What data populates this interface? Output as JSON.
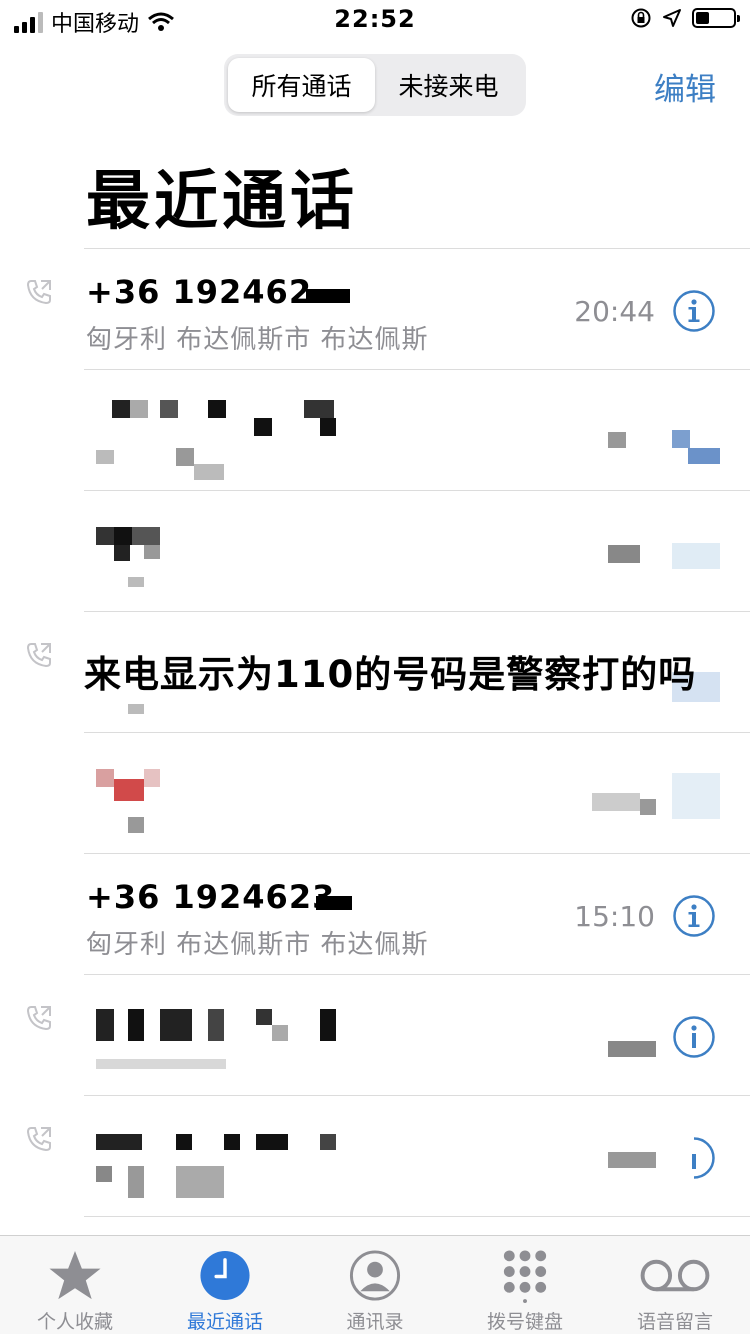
{
  "status": {
    "carrier": "中国移动",
    "time": "22:52",
    "battery_level": 0.35
  },
  "header": {
    "segments": [
      {
        "label": "所有通话",
        "active": true
      },
      {
        "label": "未接来电",
        "active": false
      }
    ],
    "edit_label": "编辑",
    "title": "最近通话"
  },
  "calls": [
    {
      "number": "+36 192462",
      "location": "匈牙利 布达佩斯市 布达佩斯",
      "time": "20:44"
    },
    {
      "number": "+36 1924623",
      "location": "匈牙利 布达佩斯市 布达佩斯",
      "time": "15:10"
    }
  ],
  "overlay_caption": "来电显示为110的号码是警察打的吗",
  "tabbar": {
    "items": [
      {
        "label": "个人收藏",
        "icon": "star-icon"
      },
      {
        "label": "最近通话",
        "icon": "clock-icon"
      },
      {
        "label": "通讯录",
        "icon": "contact-icon"
      },
      {
        "label": "拨号键盘",
        "icon": "keypad-icon"
      },
      {
        "label": "语音留言",
        "icon": "voicemail-icon"
      }
    ]
  },
  "colors": {
    "accent": "#2f79d8",
    "secondary_text": "#8e8e93"
  }
}
